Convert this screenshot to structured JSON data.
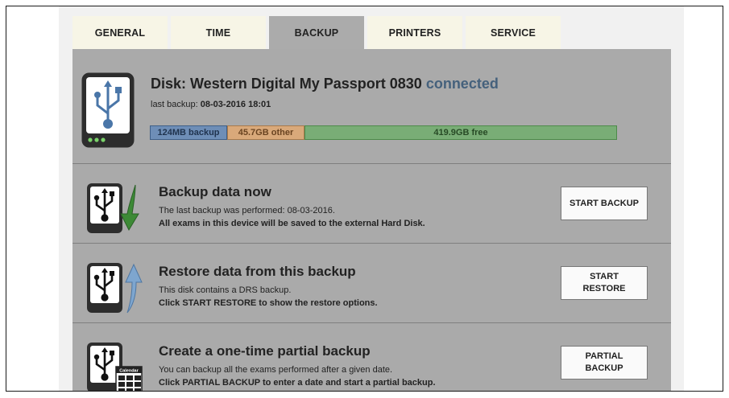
{
  "tabs": [
    {
      "label": "GENERAL"
    },
    {
      "label": "TIME"
    },
    {
      "label": "BACKUP",
      "active": true
    },
    {
      "label": "PRINTERS"
    },
    {
      "label": "SERVICE"
    }
  ],
  "disk": {
    "title": "Disk: Western Digital My Passport 0830",
    "status": "connected",
    "last_backup_label": "last backup:",
    "last_backup_value": "08-03-2016 18:01",
    "usage": {
      "backup": "124MB backup",
      "other": "45.7GB other",
      "free": "419.9GB free"
    },
    "icon": "usb-drive-icon"
  },
  "actions": [
    {
      "title": "Backup data now",
      "line1": "The last backup was performed: 08-03-2016.",
      "line2": "All exams in this device will be saved to the external Hard Disk.",
      "button": "START BACKUP",
      "icon": "usb-backup-arrow-icon"
    },
    {
      "title": "Restore data from this backup",
      "line1": "This disk contains a DRS backup.",
      "line2": "Click START RESTORE to show the restore options.",
      "button": "START RESTORE",
      "icon": "usb-restore-arrow-icon"
    },
    {
      "title": "Create a one-time partial backup",
      "line1": "You can backup all the exams performed after a given date.",
      "line2": "Click PARTIAL BACKUP to enter a date and start a partial backup.",
      "button": "PARTIAL BACKUP",
      "icon": "usb-calendar-icon",
      "calendar_label": "Calendar"
    }
  ],
  "colors": {
    "status_connected": "#45617c",
    "tab_bg": "#f7f5e6",
    "tab_active_bg": "#ababab",
    "content_bg": "#aaaaaa",
    "bar_backup": "#6e8eb7",
    "bar_other": "#d9a97a",
    "bar_free": "#79ad76"
  }
}
